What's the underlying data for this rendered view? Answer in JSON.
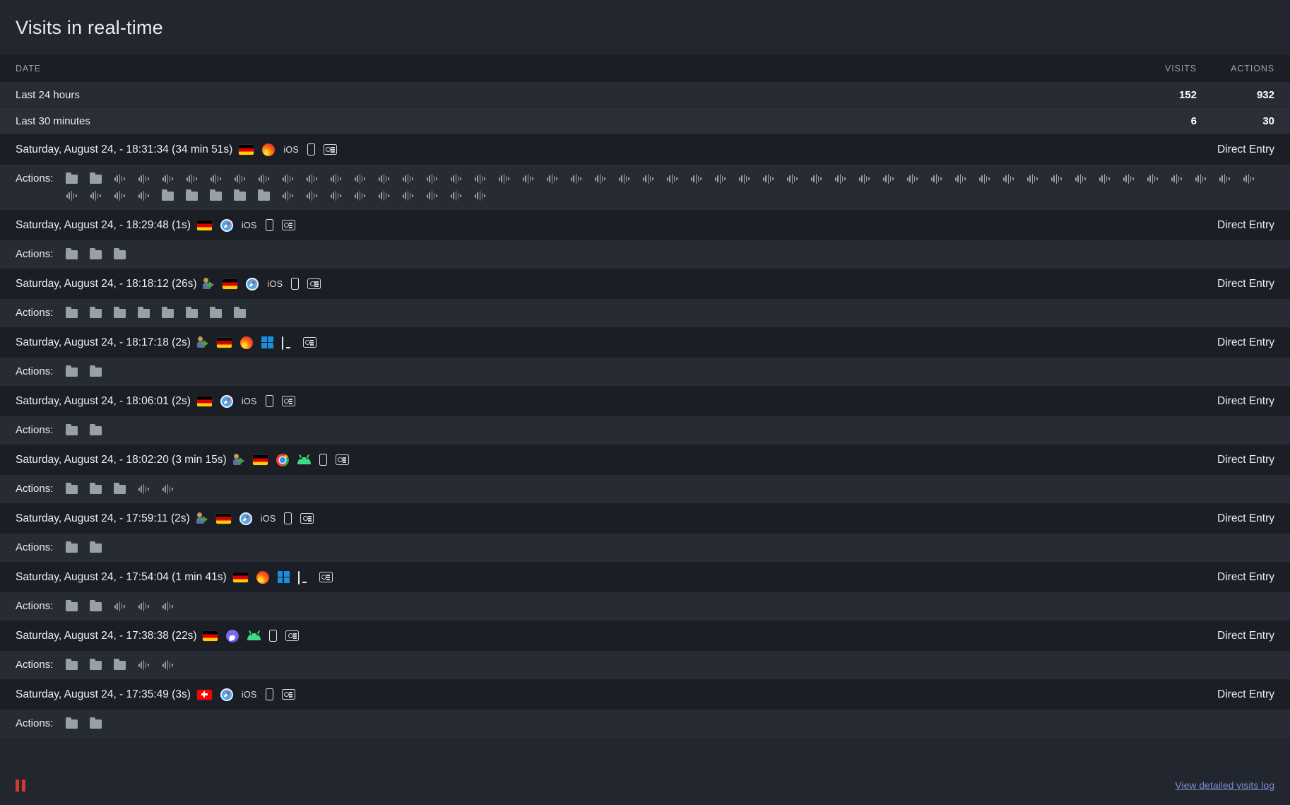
{
  "widget": {
    "title": "Visits in real-time"
  },
  "table": {
    "columns": {
      "date": "DATE",
      "visits": "VISITS",
      "actions": "ACTIONS"
    },
    "summary": [
      {
        "label": "Last 24 hours",
        "visits": "152",
        "actions": "932"
      },
      {
        "label": "Last 30 minutes",
        "visits": "6",
        "actions": "30"
      }
    ]
  },
  "visits": [
    {
      "datetime": "Saturday, August 24, - 18:31:34 (34 min 51s)",
      "returning": false,
      "country": "de",
      "browser": "firefox",
      "os": "iOS",
      "device": "phone",
      "referrer": "Direct Entry",
      "actions_label": "Actions:",
      "actions": [
        "folder",
        "folder",
        "wave",
        "wave",
        "wave",
        "wave",
        "wave",
        "wave",
        "wave",
        "wave",
        "wave",
        "wave",
        "wave",
        "wave",
        "wave",
        "wave",
        "wave",
        "wave",
        "wave",
        "wave",
        "wave",
        "wave",
        "wave",
        "wave",
        "wave",
        "wave",
        "wave",
        "wave",
        "wave",
        "wave",
        "wave",
        "wave",
        "wave",
        "wave",
        "wave",
        "wave",
        "wave",
        "wave",
        "wave",
        "wave",
        "wave",
        "wave",
        "wave",
        "wave",
        "wave",
        "wave",
        "wave",
        "wave",
        "wave",
        "wave",
        "wave",
        "wave",
        "wave",
        "wave",
        "folder",
        "folder",
        "folder",
        "folder",
        "folder",
        "wave",
        "wave",
        "wave",
        "wave",
        "wave",
        "wave",
        "wave",
        "wave",
        "wave"
      ]
    },
    {
      "datetime": "Saturday, August 24, - 18:29:48 (1s)",
      "returning": false,
      "country": "de",
      "browser": "safari",
      "os": "iOS",
      "device": "phone",
      "referrer": "Direct Entry",
      "actions_label": "Actions:",
      "actions": [
        "folder",
        "folder",
        "folder"
      ]
    },
    {
      "datetime": "Saturday, August 24, - 18:18:12 (26s)",
      "returning": true,
      "country": "de",
      "browser": "safari",
      "os": "iOS",
      "device": "phone",
      "referrer": "Direct Entry",
      "actions_label": "Actions:",
      "actions": [
        "folder",
        "folder",
        "folder",
        "folder",
        "folder",
        "folder",
        "folder",
        "folder"
      ]
    },
    {
      "datetime": "Saturday, August 24, - 18:17:18 (2s)",
      "returning": true,
      "country": "de",
      "browser": "firefox",
      "os": "windows",
      "device": "desktop",
      "referrer": "Direct Entry",
      "actions_label": "Actions:",
      "actions": [
        "folder",
        "folder"
      ]
    },
    {
      "datetime": "Saturday, August 24, - 18:06:01 (2s)",
      "returning": false,
      "country": "de",
      "browser": "safari",
      "os": "iOS",
      "device": "phone",
      "referrer": "Direct Entry",
      "actions_label": "Actions:",
      "actions": [
        "folder",
        "folder"
      ]
    },
    {
      "datetime": "Saturday, August 24, - 18:02:20 (3 min 15s)",
      "returning": true,
      "country": "de",
      "browser": "chrome",
      "os": "android",
      "device": "phone",
      "referrer": "Direct Entry",
      "actions_label": "Actions:",
      "actions": [
        "folder",
        "folder",
        "folder",
        "wave",
        "wave"
      ]
    },
    {
      "datetime": "Saturday, August 24, - 17:59:11 (2s)",
      "returning": true,
      "country": "de",
      "browser": "safari",
      "os": "iOS",
      "device": "phone",
      "referrer": "Direct Entry",
      "actions_label": "Actions:",
      "actions": [
        "folder",
        "folder"
      ]
    },
    {
      "datetime": "Saturday, August 24, - 17:54:04 (1 min 41s)",
      "returning": false,
      "country": "de",
      "browser": "firefox",
      "os": "windows",
      "device": "desktop",
      "referrer": "Direct Entry",
      "actions_label": "Actions:",
      "actions": [
        "folder",
        "folder",
        "wave",
        "wave",
        "wave"
      ]
    },
    {
      "datetime": "Saturday, August 24, - 17:38:38 (22s)",
      "returning": false,
      "country": "de",
      "browser": "samsung",
      "os": "android",
      "device": "phone",
      "referrer": "Direct Entry",
      "actions_label": "Actions:",
      "actions": [
        "folder",
        "folder",
        "folder",
        "wave",
        "wave"
      ]
    },
    {
      "datetime": "Saturday, August 24, - 17:35:49 (3s)",
      "returning": false,
      "country": "ch",
      "browser": "safari",
      "os": "iOS",
      "device": "phone",
      "referrer": "Direct Entry",
      "actions_label": "Actions:",
      "actions": [
        "folder",
        "folder"
      ]
    }
  ],
  "footer": {
    "pause_icon": "pause-icon",
    "detailed_log_link": "View detailed visits log"
  },
  "colors": {
    "widget_bg": "#22262e",
    "row_bg": "#1b1e24",
    "actions_bg": "#272b33",
    "link": "#7b8bd0",
    "pause": "#d33a2c"
  }
}
